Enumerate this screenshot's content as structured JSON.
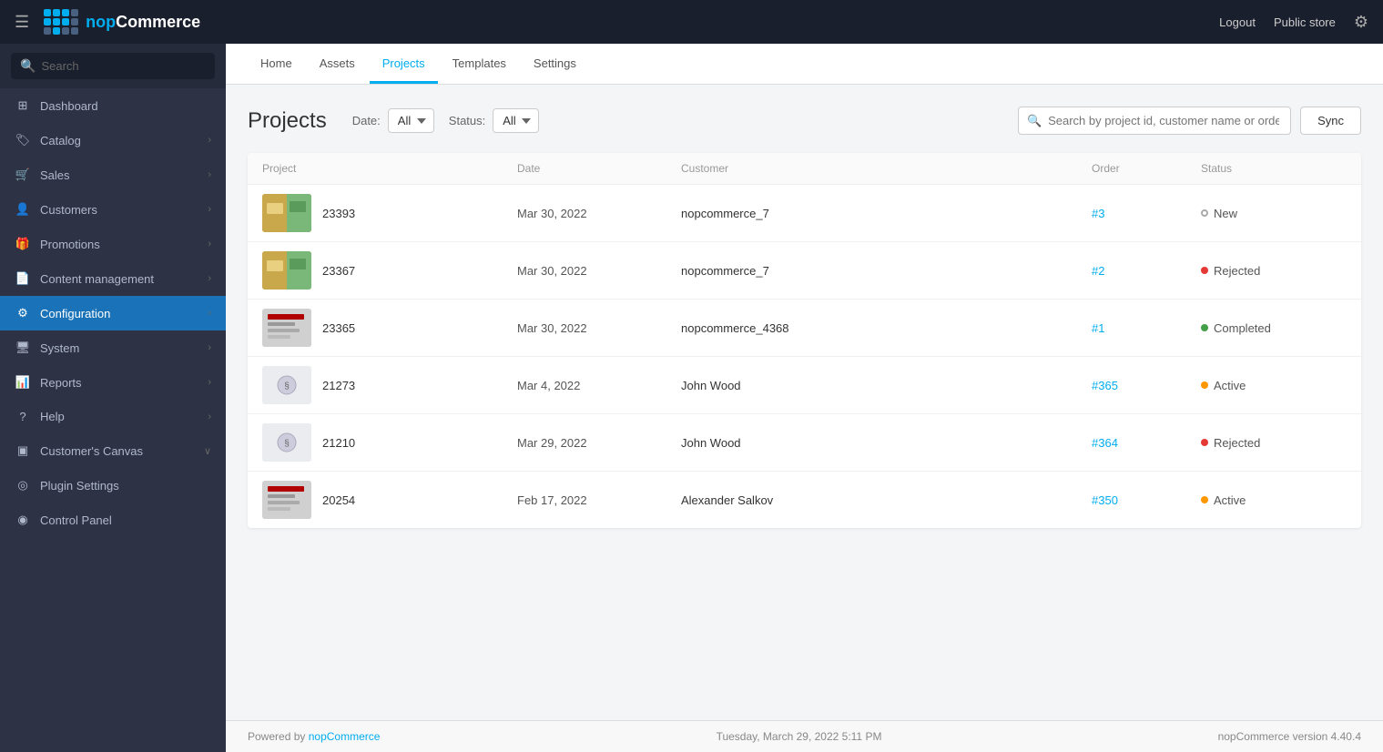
{
  "topbar": {
    "brand_name": "nopCommerce",
    "brand_prefix": "nop",
    "logout_label": "Logout",
    "public_store_label": "Public store"
  },
  "sidebar": {
    "search_placeholder": "Search",
    "items": [
      {
        "id": "dashboard",
        "label": "Dashboard",
        "icon": "grid",
        "active": false,
        "has_children": false
      },
      {
        "id": "catalog",
        "label": "Catalog",
        "icon": "tag",
        "active": false,
        "has_children": true
      },
      {
        "id": "sales",
        "label": "Sales",
        "icon": "cart",
        "active": false,
        "has_children": true
      },
      {
        "id": "customers",
        "label": "Customers",
        "icon": "person",
        "active": false,
        "has_children": true
      },
      {
        "id": "promotions",
        "label": "Promotions",
        "icon": "gift",
        "active": false,
        "has_children": true
      },
      {
        "id": "content-management",
        "label": "Content management",
        "icon": "file",
        "active": false,
        "has_children": true
      },
      {
        "id": "configuration",
        "label": "Configuration",
        "icon": "gear",
        "active": true,
        "has_children": true
      },
      {
        "id": "system",
        "label": "System",
        "icon": "monitor",
        "active": false,
        "has_children": true
      },
      {
        "id": "reports",
        "label": "Reports",
        "icon": "chart",
        "active": false,
        "has_children": true
      },
      {
        "id": "help",
        "label": "Help",
        "icon": "question",
        "active": false,
        "has_children": true
      },
      {
        "id": "customers-canvas",
        "label": "Customer's Canvas",
        "icon": "canvas",
        "active": false,
        "has_children": true
      },
      {
        "id": "plugin-settings",
        "label": "Plugin Settings",
        "icon": "circle-gear",
        "active": false,
        "has_children": false
      },
      {
        "id": "control-panel",
        "label": "Control Panel",
        "icon": "circle-grid",
        "active": false,
        "has_children": false
      }
    ]
  },
  "tabs": [
    {
      "id": "home",
      "label": "Home",
      "active": false
    },
    {
      "id": "assets",
      "label": "Assets",
      "active": false
    },
    {
      "id": "projects",
      "label": "Projects",
      "active": true
    },
    {
      "id": "templates",
      "label": "Templates",
      "active": false
    },
    {
      "id": "settings",
      "label": "Settings",
      "active": false
    }
  ],
  "main": {
    "page_title": "Projects",
    "date_filter_label": "Date:",
    "date_filter_value": "All",
    "status_filter_label": "Status:",
    "status_filter_value": "All",
    "search_placeholder": "Search by project id, customer name or orde",
    "sync_button": "Sync",
    "table": {
      "columns": [
        {
          "id": "project",
          "label": "Project"
        },
        {
          "id": "date",
          "label": "Date"
        },
        {
          "id": "customer",
          "label": "Customer"
        },
        {
          "id": "order",
          "label": "Order"
        },
        {
          "id": "status",
          "label": "Status"
        }
      ],
      "rows": [
        {
          "id": "row-23393",
          "project_id": "23393",
          "thumb_class": "thumb-23393",
          "date": "Mar 30, 2022",
          "customer": "nopcommerce_7",
          "order": "#3",
          "status": "New",
          "status_class": "dot-new"
        },
        {
          "id": "row-23367",
          "project_id": "23367",
          "thumb_class": "thumb-23367",
          "date": "Mar 30, 2022",
          "customer": "nopcommerce_7",
          "order": "#2",
          "status": "Rejected",
          "status_class": "dot-rejected"
        },
        {
          "id": "row-23365",
          "project_id": "23365",
          "thumb_class": "thumb-23365",
          "date": "Mar 30, 2022",
          "customer": "nopcommerce_4368",
          "order": "#1",
          "status": "Completed",
          "status_class": "dot-completed"
        },
        {
          "id": "row-21273",
          "project_id": "21273",
          "thumb_class": "thumb-21273",
          "date": "Mar 4, 2022",
          "customer": "John Wood",
          "order": "#365",
          "status": "Active",
          "status_class": "dot-active"
        },
        {
          "id": "row-21210",
          "project_id": "21210",
          "thumb_class": "thumb-21210",
          "date": "Mar 29, 2022",
          "customer": "John Wood",
          "order": "#364",
          "status": "Rejected",
          "status_class": "dot-rejected"
        },
        {
          "id": "row-20254",
          "project_id": "20254",
          "thumb_class": "thumb-20254",
          "date": "Feb 17, 2022",
          "customer": "Alexander Salkov",
          "order": "#350",
          "status": "Active",
          "status_class": "dot-active"
        }
      ]
    }
  },
  "footer": {
    "powered_by": "Powered by",
    "brand_link": "nopCommerce",
    "timestamp": "Tuesday, March 29, 2022 5:11 PM",
    "version": "nopCommerce version 4.40.4"
  }
}
